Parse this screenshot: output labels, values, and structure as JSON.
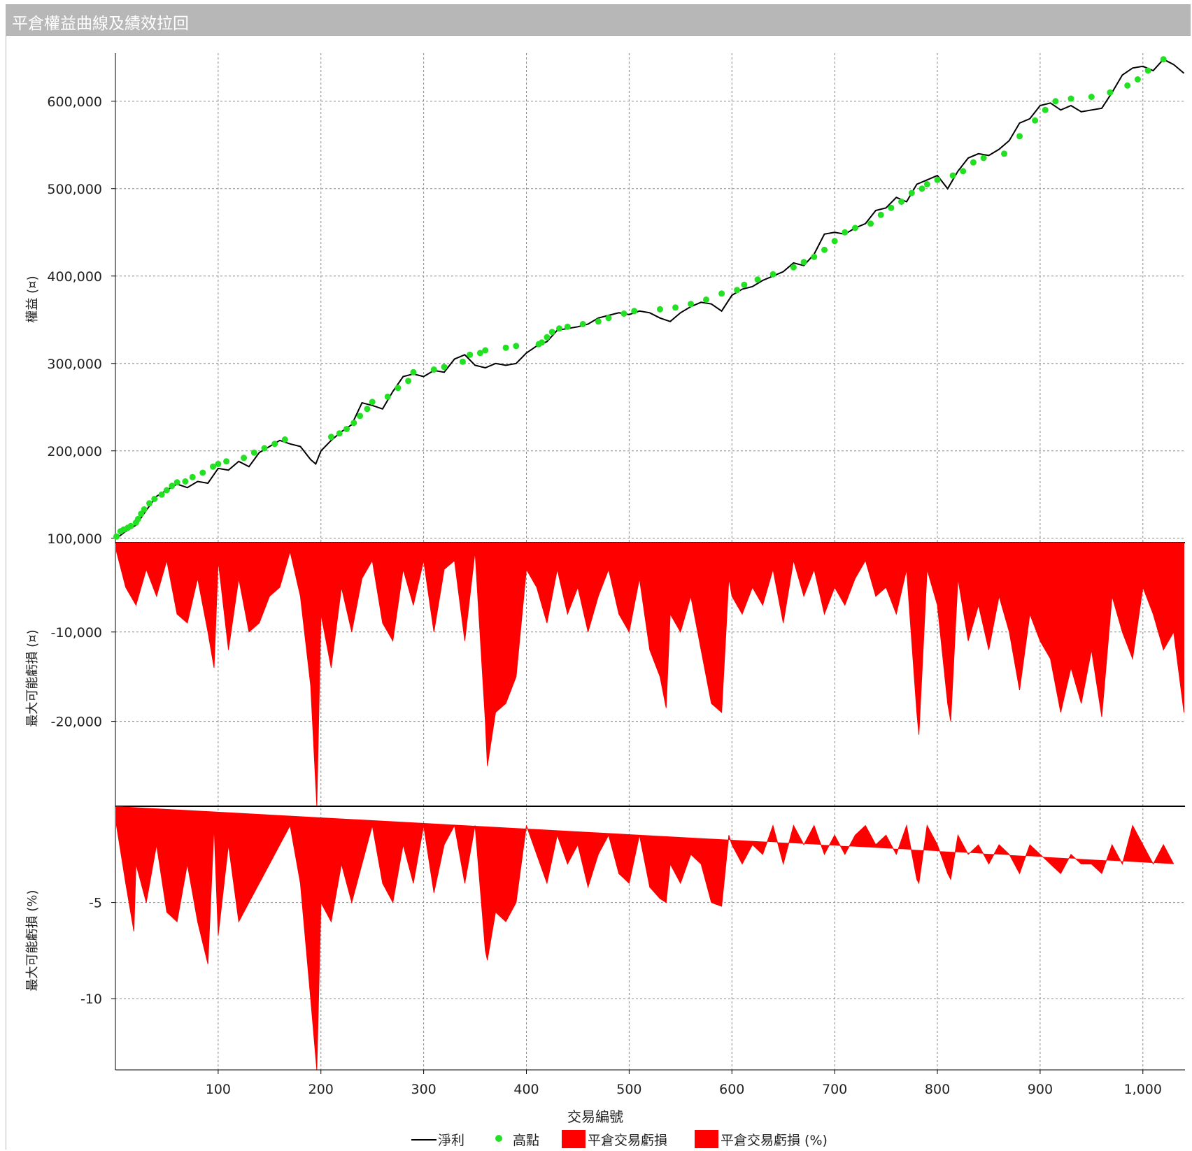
{
  "window": {
    "title": "平倉權益曲線及績效拉回"
  },
  "colors": {
    "line": "#000000",
    "highs": "#22e022",
    "drawdown": "#ff0000",
    "grid": "#8a8a8a"
  },
  "chart_data": [
    {
      "type": "line",
      "panel": "equity",
      "ylabel": "權益 (¤)",
      "yticks": [
        100000,
        200000,
        300000,
        400000,
        500000,
        600000
      ],
      "ytick_labels": [
        "100,000",
        "200,000",
        "300,000",
        "400,000",
        "500,000",
        "600,000"
      ],
      "ylim": [
        95000,
        655000
      ],
      "grid": true,
      "series": [
        {
          "name": "淨利",
          "type": "line",
          "x": [
            1,
            10,
            20,
            30,
            40,
            50,
            60,
            70,
            80,
            90,
            100,
            110,
            120,
            130,
            140,
            150,
            160,
            170,
            180,
            190,
            195,
            200,
            210,
            220,
            230,
            240,
            250,
            260,
            270,
            280,
            290,
            300,
            310,
            320,
            330,
            340,
            350,
            360,
            370,
            380,
            390,
            400,
            410,
            420,
            430,
            440,
            450,
            460,
            470,
            480,
            490,
            500,
            510,
            520,
            530,
            540,
            550,
            560,
            570,
            580,
            590,
            600,
            610,
            620,
            630,
            640,
            650,
            660,
            670,
            680,
            690,
            700,
            710,
            720,
            730,
            740,
            750,
            760,
            770,
            780,
            790,
            800,
            810,
            820,
            830,
            840,
            850,
            860,
            870,
            880,
            890,
            900,
            910,
            920,
            930,
            940,
            950,
            960,
            970,
            980,
            990,
            1000,
            1010,
            1020,
            1030,
            1040
          ],
          "y": [
            100000,
            108000,
            115000,
            132000,
            148000,
            155000,
            162000,
            158000,
            165000,
            163000,
            180000,
            178000,
            188000,
            182000,
            198000,
            205000,
            212000,
            208000,
            205000,
            190000,
            185000,
            200000,
            212000,
            222000,
            230000,
            255000,
            252000,
            248000,
            268000,
            285000,
            288000,
            285000,
            292000,
            290000,
            305000,
            310000,
            298000,
            295000,
            300000,
            298000,
            300000,
            312000,
            320000,
            325000,
            338000,
            340000,
            342000,
            345000,
            352000,
            355000,
            358000,
            356000,
            360000,
            358000,
            352000,
            348000,
            358000,
            365000,
            370000,
            368000,
            360000,
            378000,
            385000,
            388000,
            395000,
            400000,
            405000,
            415000,
            412000,
            425000,
            448000,
            450000,
            448000,
            455000,
            460000,
            475000,
            478000,
            490000,
            485000,
            505000,
            510000,
            515000,
            500000,
            520000,
            535000,
            540000,
            538000,
            545000,
            555000,
            575000,
            580000,
            595000,
            598000,
            590000,
            595000,
            588000,
            590000,
            592000,
            610000,
            630000,
            638000,
            640000,
            635000,
            648000,
            642000,
            632000
          ]
        },
        {
          "name": "高點",
          "type": "scatter",
          "x": [
            1,
            5,
            8,
            12,
            15,
            20,
            22,
            25,
            28,
            33,
            38,
            45,
            50,
            55,
            60,
            68,
            75,
            85,
            95,
            100,
            108,
            125,
            135,
            145,
            155,
            165,
            210,
            218,
            225,
            232,
            238,
            245,
            250,
            265,
            275,
            285,
            290,
            310,
            320,
            338,
            345,
            355,
            360,
            380,
            390,
            412,
            415,
            420,
            425,
            432,
            440,
            455,
            470,
            480,
            495,
            505,
            530,
            545,
            560,
            575,
            590,
            605,
            612,
            625,
            640,
            660,
            670,
            680,
            690,
            700,
            710,
            720,
            735,
            745,
            755,
            765,
            775,
            785,
            790,
            800,
            815,
            825,
            835,
            845,
            865,
            880,
            895,
            905,
            915,
            930,
            950,
            968,
            985,
            995,
            1005,
            1020
          ],
          "y": [
            102000,
            108000,
            110000,
            112000,
            114000,
            118000,
            122000,
            128000,
            133000,
            140000,
            145000,
            150000,
            155000,
            160000,
            164000,
            165000,
            170000,
            175000,
            182000,
            185000,
            188000,
            192000,
            198000,
            203000,
            208000,
            213000,
            216000,
            220000,
            225000,
            232000,
            240000,
            248000,
            256000,
            262000,
            272000,
            280000,
            290000,
            293000,
            296000,
            302000,
            310000,
            312000,
            315000,
            318000,
            320000,
            322000,
            324000,
            330000,
            336000,
            340000,
            342000,
            345000,
            348000,
            352000,
            357000,
            360000,
            362000,
            364000,
            368000,
            373000,
            380000,
            384000,
            390000,
            396000,
            402000,
            410000,
            416000,
            422000,
            430000,
            440000,
            450000,
            455000,
            460000,
            470000,
            478000,
            485000,
            495000,
            500000,
            505000,
            510000,
            515000,
            520000,
            530000,
            535000,
            540000,
            560000,
            578000,
            590000,
            600000,
            603000,
            605000,
            610000,
            618000,
            625000,
            635000,
            648000
          ]
        }
      ]
    },
    {
      "type": "area",
      "panel": "drawdown-value",
      "name": "平倉交易虧損",
      "ylabel": "最大可能虧損 (¤)",
      "yticks": [
        -10000,
        -20000
      ],
      "ytick_labels": [
        "-10,000",
        "-20,000"
      ],
      "ylim": [
        -29500,
        0
      ],
      "grid": true,
      "x": [
        1,
        10,
        20,
        30,
        40,
        50,
        60,
        70,
        80,
        90,
        96,
        100,
        110,
        120,
        130,
        140,
        150,
        160,
        170,
        180,
        190,
        196,
        200,
        210,
        220,
        230,
        240,
        250,
        260,
        270,
        280,
        290,
        300,
        310,
        320,
        330,
        340,
        350,
        360,
        362,
        370,
        380,
        390,
        400,
        410,
        420,
        430,
        440,
        450,
        460,
        470,
        480,
        490,
        500,
        510,
        520,
        530,
        536,
        540,
        550,
        560,
        570,
        580,
        590,
        597,
        600,
        610,
        620,
        630,
        640,
        650,
        660,
        670,
        680,
        690,
        700,
        710,
        720,
        730,
        740,
        750,
        760,
        770,
        780,
        782,
        790,
        800,
        810,
        813,
        820,
        830,
        840,
        850,
        860,
        870,
        880,
        890,
        900,
        910,
        920,
        930,
        940,
        950,
        960,
        970,
        980,
        990,
        1000,
        1010,
        1020,
        1030,
        1040
      ],
      "y": [
        -1000,
        -5000,
        -7000,
        -3000,
        -6000,
        -2000,
        -8000,
        -9000,
        -4000,
        -10000,
        -14000,
        -2000,
        -12000,
        -4000,
        -10000,
        -9000,
        -6000,
        -5000,
        -1000,
        -6000,
        -16000,
        -29500,
        -8000,
        -14000,
        -5000,
        -10000,
        -4000,
        -2000,
        -9000,
        -11000,
        -3000,
        -7000,
        -2000,
        -10000,
        -3000,
        -2000,
        -11000,
        -1000,
        -20000,
        -25000,
        -19000,
        -18000,
        -15000,
        -3000,
        -5000,
        -9000,
        -3000,
        -8000,
        -5000,
        -10000,
        -6000,
        -3000,
        -8000,
        -10000,
        -4000,
        -12000,
        -15000,
        -18500,
        -8000,
        -10000,
        -6000,
        -12000,
        -18000,
        -19000,
        -4000,
        -6000,
        -8000,
        -5000,
        -7000,
        -3000,
        -9000,
        -2000,
        -6000,
        -3000,
        -8000,
        -5000,
        -7000,
        -4000,
        -2000,
        -6000,
        -5000,
        -8000,
        -3000,
        -19000,
        -21500,
        -3000,
        -7000,
        -18000,
        -20000,
        -4000,
        -11000,
        -7000,
        -12000,
        -6000,
        -10000,
        -16500,
        -8000,
        -11000,
        -13000,
        -19000,
        -14000,
        -18000,
        -12000,
        -19500,
        -6000,
        -10000,
        -13000,
        -5000,
        -8000,
        -12000,
        -10000,
        -19000
      ]
    },
    {
      "type": "area",
      "panel": "drawdown-percent",
      "name": "平倉交易虧損 (%)",
      "ylabel": "最大可能虧損 (%)",
      "yticks": [
        -5,
        -10
      ],
      "ytick_labels": [
        "-5",
        "-10"
      ],
      "ylim": [
        -13.7,
        0
      ],
      "grid": true,
      "x": [
        1,
        10,
        18,
        20,
        30,
        40,
        50,
        60,
        70,
        80,
        90,
        96,
        100,
        110,
        120,
        130,
        140,
        150,
        160,
        170,
        180,
        190,
        196,
        200,
        210,
        220,
        230,
        240,
        250,
        260,
        270,
        280,
        290,
        300,
        310,
        320,
        330,
        340,
        350,
        360,
        362,
        370,
        380,
        390,
        400,
        410,
        420,
        430,
        440,
        450,
        460,
        470,
        480,
        490,
        500,
        510,
        520,
        530,
        536,
        540,
        550,
        560,
        570,
        580,
        590,
        597,
        600,
        610,
        620,
        630,
        640,
        650,
        660,
        670,
        680,
        690,
        700,
        710,
        720,
        730,
        740,
        750,
        760,
        770,
        780,
        782,
        790,
        800,
        810,
        813,
        820,
        830,
        840,
        850,
        860,
        870,
        880,
        890,
        900,
        910,
        920,
        930,
        940,
        950,
        960,
        970,
        980,
        990,
        1000,
        1010,
        1020,
        1030,
        1040
      ],
      "y": [
        -1,
        -4,
        -6.5,
        -3,
        -5,
        -2,
        -5.5,
        -6,
        -3,
        -6,
        -8.2,
        -1,
        -6.7,
        -2,
        -6,
        -5,
        -4,
        -3,
        -2,
        -1,
        -4,
        -10,
        -13.7,
        -5,
        -6,
        -3,
        -5,
        -3,
        -1,
        -4,
        -5,
        -2,
        -4,
        -1,
        -4.5,
        -2,
        -1,
        -4,
        -1,
        -7.5,
        -8,
        -5.5,
        -6,
        -5,
        -1,
        -2.5,
        -4,
        -1.5,
        -3,
        -2,
        -4.2,
        -2.5,
        -1.5,
        -3.5,
        -4,
        -1.5,
        -4.2,
        -4.8,
        -5,
        -3,
        -4,
        -2.5,
        -3,
        -5,
        -5.2,
        -1.5,
        -2,
        -3,
        -2,
        -2.5,
        -1,
        -3,
        -1,
        -2,
        -1,
        -2.5,
        -1.5,
        -2.5,
        -1.5,
        -1,
        -2,
        -1.5,
        -2.5,
        -1,
        -3.8,
        -4,
        -1,
        -2,
        -3.5,
        -3.8,
        -1.5,
        -2.5,
        -2,
        -3,
        -2,
        -2.5,
        -3.5,
        -2,
        -2.5,
        -3,
        -3.5,
        -2.5,
        -3,
        -3,
        -3.5,
        -2,
        -3,
        -1,
        -2,
        -3,
        -2,
        -3
      ]
    }
  ],
  "x_axis": {
    "label": "交易編號",
    "ticks": [
      100,
      200,
      300,
      400,
      500,
      600,
      700,
      800,
      900,
      1000
    ],
    "tick_labels": [
      "100",
      "200",
      "300",
      "400",
      "500",
      "600",
      "700",
      "800",
      "900",
      "1,000"
    ],
    "xlim": [
      0,
      1041
    ]
  },
  "legend": [
    {
      "label": "淨利",
      "type": "line"
    },
    {
      "label": "高點",
      "type": "dot"
    },
    {
      "label": "平倉交易虧損",
      "type": "swatch"
    },
    {
      "label": "平倉交易虧損 (%)",
      "type": "swatch"
    }
  ]
}
